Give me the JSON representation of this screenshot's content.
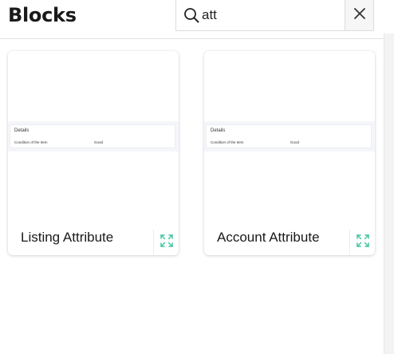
{
  "header": {
    "title": "Blocks",
    "search": {
      "value": "att",
      "placeholder": ""
    }
  },
  "cards": [
    {
      "label": "Listing Attribute",
      "preview": {
        "heading": "Details",
        "key": "Condition of the Item",
        "value": "Good"
      }
    },
    {
      "label": "Account Attribute",
      "preview": {
        "heading": "Details",
        "key": "Condition of the Item",
        "value": "Good"
      }
    }
  ],
  "icons": {
    "search": "search-icon",
    "clear": "close-icon",
    "expand": "expand-icon"
  },
  "colors": {
    "accent": "#3cc29f",
    "preview_band": "#f4f6fa"
  }
}
